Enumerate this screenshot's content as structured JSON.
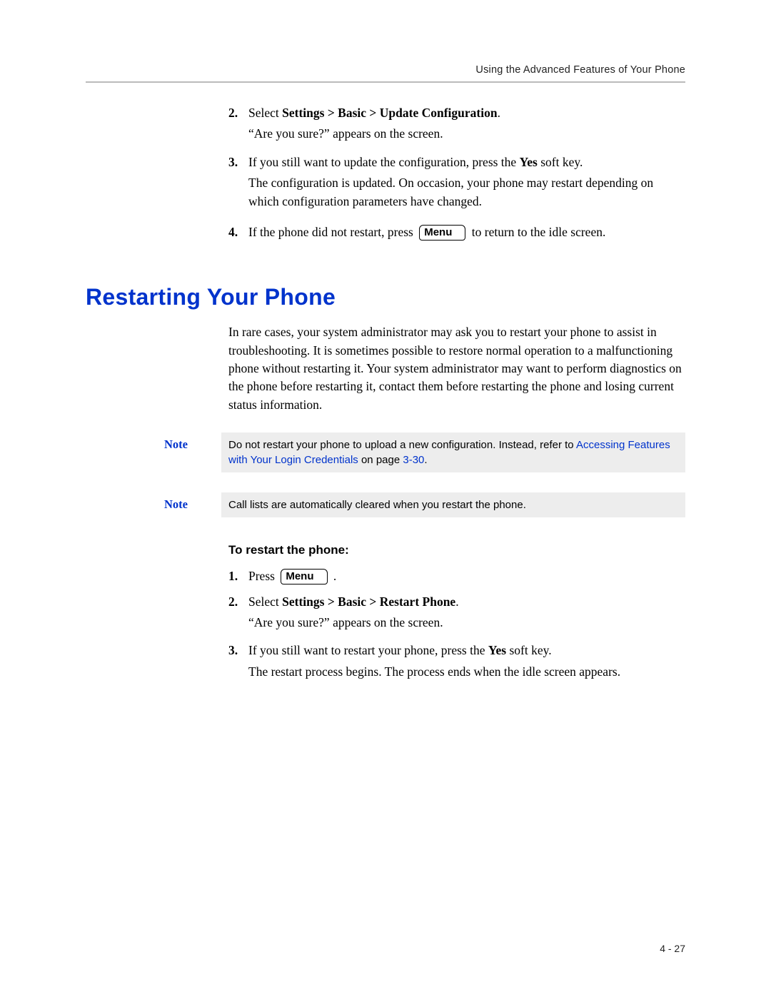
{
  "header": {
    "running_head": "Using the Advanced Features of Your Phone"
  },
  "top_steps": {
    "s2": {
      "num": "2.",
      "lead": "Select ",
      "bold": "Settings > Basic > Update Configuration",
      "tail": ".",
      "after": "“Are you sure?” appears on the screen."
    },
    "s3": {
      "num": "3.",
      "line_a": "If you still want to update the configuration, press the ",
      "yes": "Yes",
      "line_b": " soft key.",
      "after": "The configuration is updated. On occasion, your phone may restart depending on which configuration parameters have changed."
    },
    "s4": {
      "num": "4.",
      "before": "If the phone did not restart, press ",
      "key": "Menu",
      "after_key": " to return to the idle screen."
    }
  },
  "section": {
    "title": "Restarting Your Phone",
    "intro": "In rare cases, your system administrator may ask you to restart your phone to assist in troubleshooting. It is sometimes possible to restore normal operation to a malfunctioning phone without restarting it. Your system administrator may want to perform diagnostics on the phone before restarting it, contact them before restarting the phone and losing current status information."
  },
  "notes": {
    "label": "Note",
    "n1": {
      "pre": "Do not restart your phone to upload a new configuration. Instead, refer to ",
      "link": "Accessing Features with Your Login Credentials",
      "mid": " on page ",
      "pageref": "3-30",
      "post": "."
    },
    "n2": {
      "text": "Call lists are automatically cleared when you restart the phone."
    }
  },
  "restart": {
    "subhead": "To restart the phone:",
    "s1": {
      "num": "1.",
      "before": "Press ",
      "key": "Menu",
      "after": " ."
    },
    "s2": {
      "num": "2.",
      "lead": "Select ",
      "bold": "Settings > Basic > Restart Phone",
      "tail": ".",
      "after": "“Are you sure?” appears on the screen."
    },
    "s3": {
      "num": "3.",
      "line_a": "If you still want to restart your phone, press the ",
      "yes": "Yes",
      "line_b": " soft key.",
      "after": "The restart process begins. The process ends when the idle screen appears."
    }
  },
  "footer": {
    "page_number": "4 - 27"
  }
}
